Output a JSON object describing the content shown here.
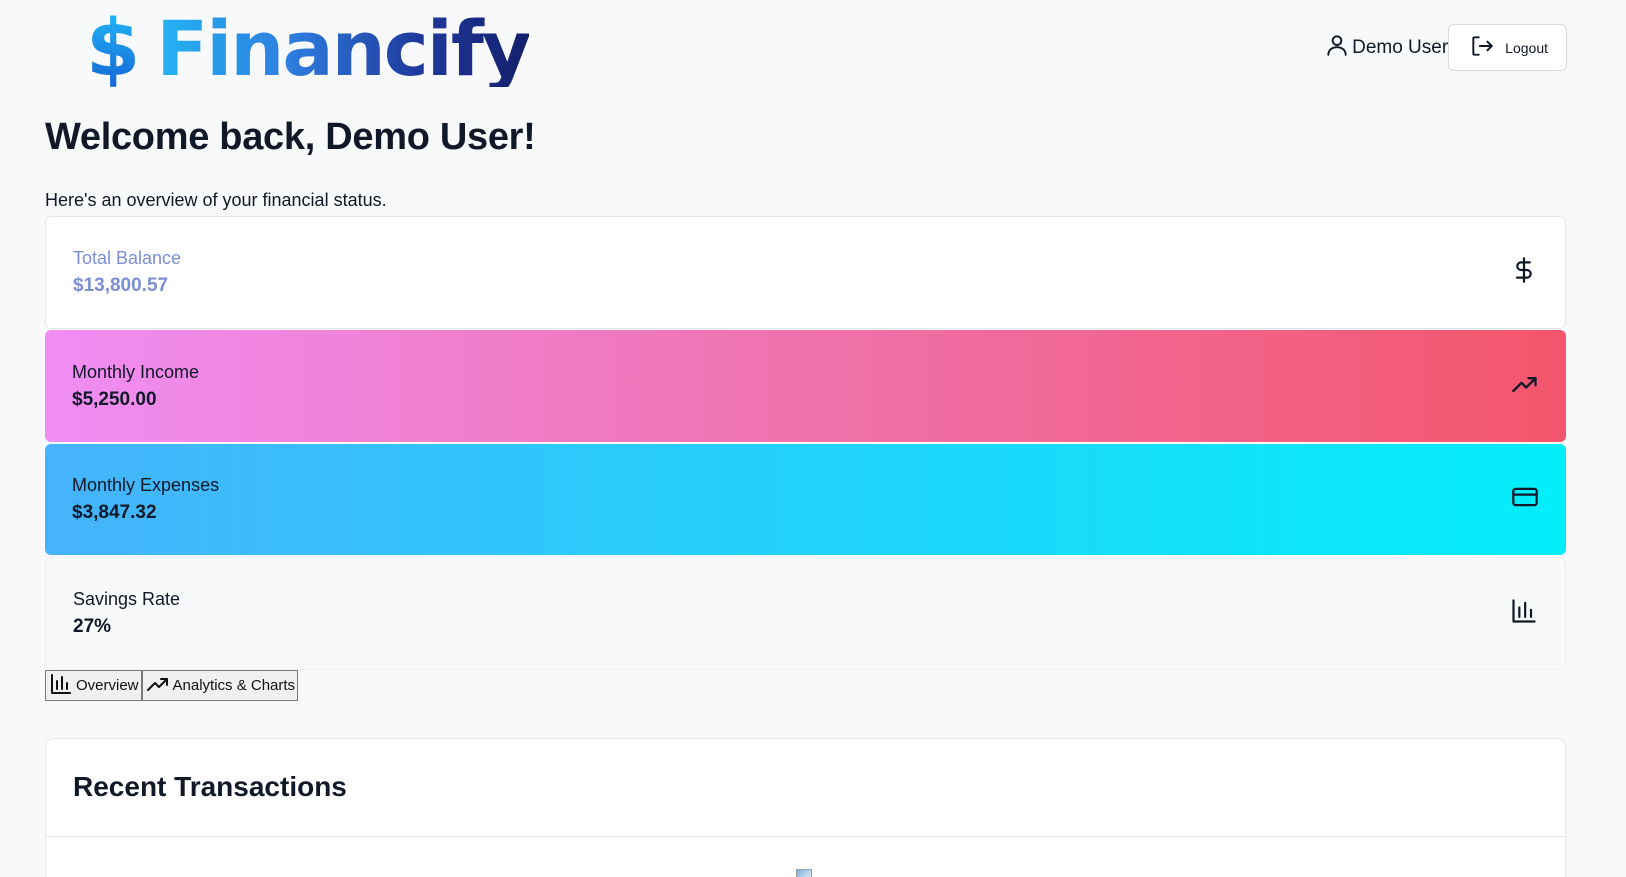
{
  "header": {
    "logo_symbol": "$",
    "logo_text": "Financify",
    "user_name": "Demo User",
    "logout_label": "Logout"
  },
  "welcome": {
    "title": "Welcome back, Demo User!",
    "subtitle": "Here's an overview of your financial status."
  },
  "stats": [
    {
      "label": "Total Balance",
      "value": "$13,800.57",
      "icon": "dollar-icon"
    },
    {
      "label": "Monthly Income",
      "value": "$5,250.00",
      "icon": "trending-up-icon"
    },
    {
      "label": "Monthly Expenses",
      "value": "$3,847.32",
      "icon": "credit-card-icon"
    },
    {
      "label": "Savings Rate",
      "value": "27%",
      "icon": "bar-chart-icon"
    }
  ],
  "tabs": [
    {
      "label": "Overview",
      "icon": "bar-chart-icon"
    },
    {
      "label": "Analytics & Charts",
      "icon": "trending-up-icon"
    }
  ],
  "recent": {
    "title": "Recent Transactions"
  },
  "colors": {
    "balance_text": "#7b8fd6",
    "income_gradient": [
      "#f08ef4",
      "#f3566b"
    ],
    "expenses_gradient": [
      "#46b3fb",
      "#03eefa"
    ],
    "logo_gradient": [
      "#23b4f2",
      "#141f6b"
    ]
  }
}
